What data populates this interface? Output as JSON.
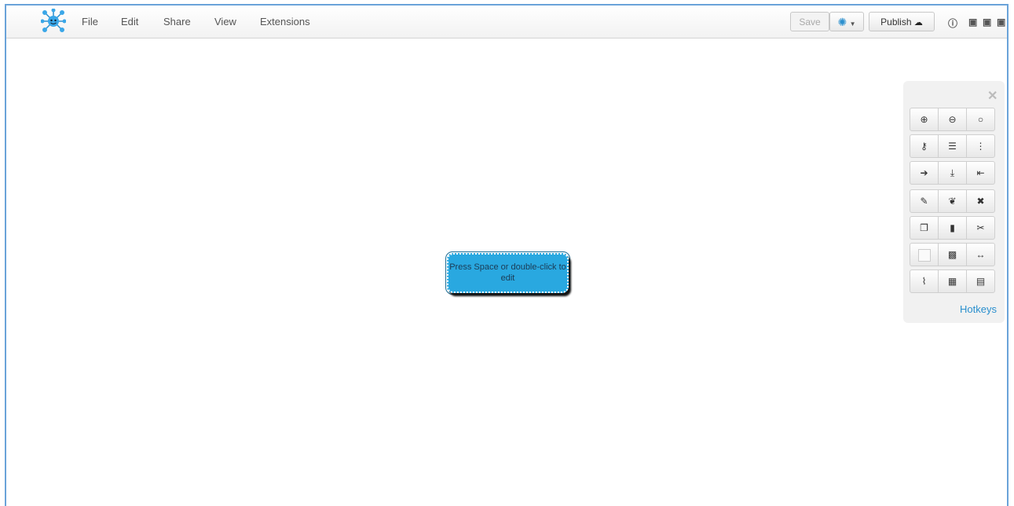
{
  "menu": {
    "file": "File",
    "edit": "Edit",
    "share": "Share",
    "view": "View",
    "extensions": "Extensions"
  },
  "toolbar": {
    "save_label": "Save",
    "publish_label": "Publish",
    "publish_icon": "☁"
  },
  "toolbox": {
    "close": "✕",
    "hotkeys": "Hotkeys",
    "rows": [
      [
        "zoom-in-icon",
        "zoom-out-icon",
        "reset-zoom-icon"
      ],
      [
        "sitemap-icon",
        "list-icon",
        "ellipsis-icon"
      ],
      [
        "add-child-icon",
        "add-sibling-icon",
        "add-parent-icon"
      ],
      [
        "edit-icon",
        "leaf-icon",
        "delete-icon"
      ],
      [
        "copy-icon",
        "paste-icon",
        "cut-icon"
      ],
      [
        "color-swatch-icon",
        "image-icon",
        "width-icon"
      ],
      [
        "attachment-icon",
        "table-icon",
        "film-icon"
      ]
    ]
  },
  "node": {
    "text": "Press Space or double-click to edit"
  },
  "colors": {
    "accent": "#29a8e0",
    "link": "#2a8fce",
    "frame": "#6aa3d9"
  }
}
